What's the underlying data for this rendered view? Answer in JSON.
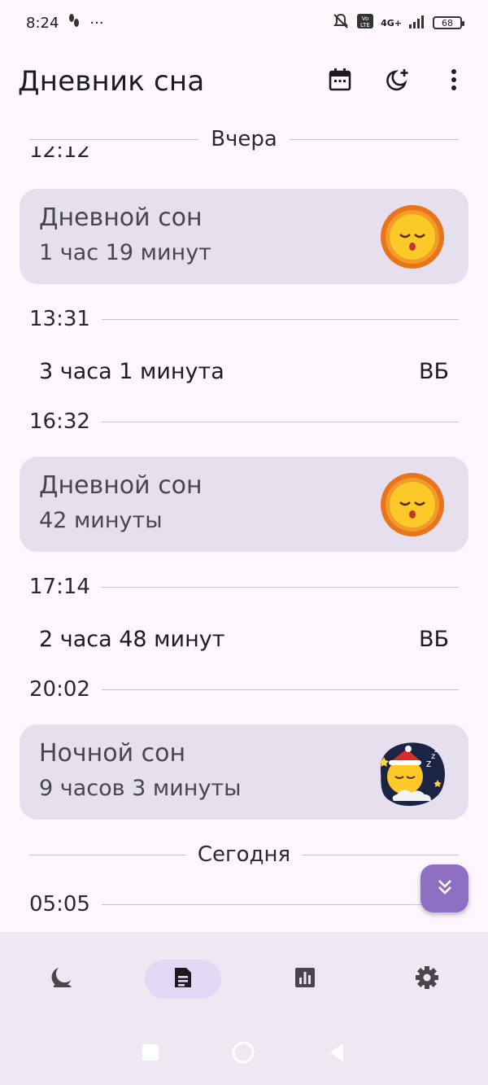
{
  "status_bar": {
    "time": "8:24",
    "dots": "···",
    "network": "4G+",
    "battery": "68"
  },
  "app_bar": {
    "title": "Дневник сна",
    "actions": [
      "calendar-icon",
      "moon-add-icon",
      "more-vert-icon"
    ]
  },
  "diary": {
    "cut_time": "12:12",
    "day_yesterday": "Вчера",
    "day_today": "Сегодня",
    "entries": [
      {
        "label": "Дневной сон",
        "duration": "1 час 19 минут",
        "icon": "sun-sleeping-icon"
      },
      {
        "time": "13:31"
      },
      {
        "awake": "3 часа 1 минута",
        "tag": "ВБ"
      },
      {
        "time": "16:32"
      },
      {
        "label": "Дневной сон",
        "duration": "42 минуты",
        "icon": "sun-sleeping-icon"
      },
      {
        "time": "17:14"
      },
      {
        "awake": "2 часа 48 минут",
        "tag": "ВБ"
      },
      {
        "time": "20:02"
      },
      {
        "label": "Ночной сон",
        "duration": "9 часов 3 минуты",
        "icon": "moon-sleeping-icon"
      },
      {
        "time": "05:05"
      }
    ]
  },
  "fab": {
    "icon": "double-chevron-down-icon"
  },
  "bottom_nav": {
    "items": [
      {
        "icon": "moon-nav-icon",
        "active": false
      },
      {
        "icon": "diary-nav-icon",
        "active": true
      },
      {
        "icon": "stats-nav-icon",
        "active": false
      },
      {
        "icon": "settings-nav-icon",
        "active": false
      }
    ]
  },
  "colors": {
    "background": "#fdf7fd",
    "card": "#e6e0ee",
    "fab": "#8e6fc2",
    "nav_background": "#efe8f2",
    "nav_active": "#e3d8f6"
  }
}
